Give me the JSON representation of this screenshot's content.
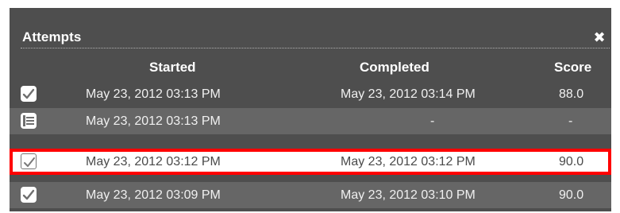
{
  "window": {
    "title": "Attempts",
    "close_glyph": "✖"
  },
  "columns": {
    "started": "Started",
    "completed": "Completed",
    "score": "Score"
  },
  "attempts": [
    {
      "icon": "completed-check-icon",
      "started": "May 23, 2012 03:13 PM",
      "completed": "May 23, 2012 03:14 PM",
      "score": "88.0"
    },
    {
      "icon": "in-progress-document-icon",
      "started": "May 23, 2012 03:13 PM",
      "completed": "-",
      "score": "-"
    },
    {
      "icon": "completed-check-icon",
      "started": "May 23, 2012 03:12 PM",
      "completed": "May 23, 2012 03:12 PM",
      "score": "90.0",
      "selected": true
    },
    {
      "icon": "completed-check-icon",
      "started": "May 23, 2012 03:09 PM",
      "completed": "May 23, 2012 03:10 PM",
      "score": "90.0"
    }
  ],
  "colors": {
    "panel": "#4e4e4e",
    "alt_row": "#666666",
    "highlight": "#ff0000"
  }
}
